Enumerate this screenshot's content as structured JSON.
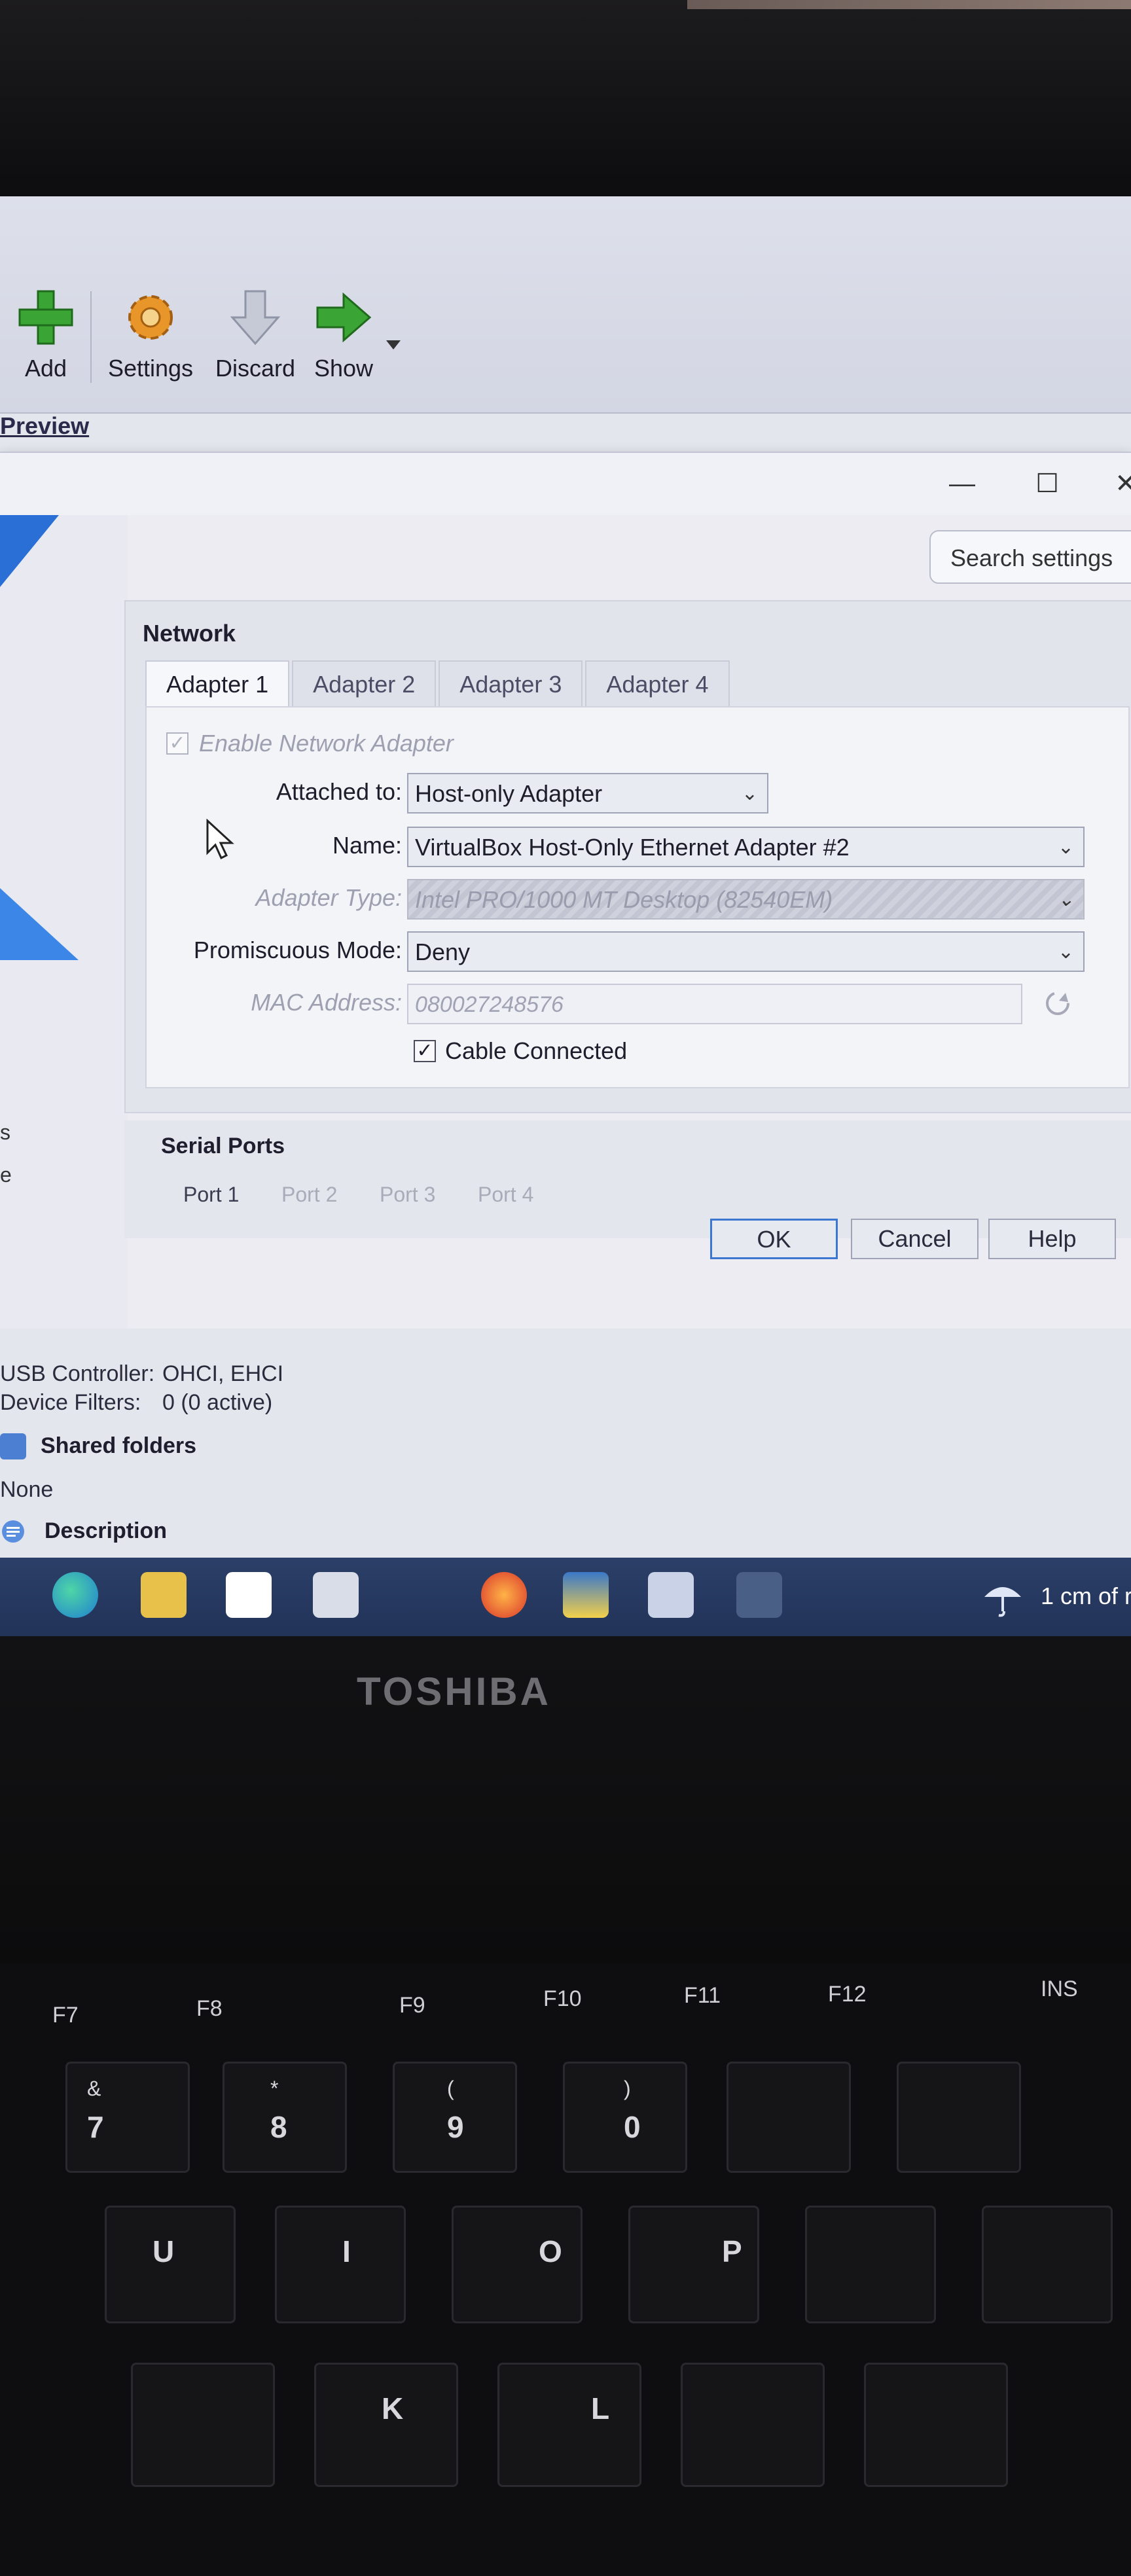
{
  "toolbar": {
    "add_label": "Add",
    "settings_label": "Settings",
    "discard_label": "Discard",
    "show_label": "Show"
  },
  "preview_label": "Preview",
  "dialog": {
    "minimize": "—",
    "maximize": "☐",
    "close": "✕",
    "search_placeholder": "Search settings",
    "network_title": "Network",
    "tabs": [
      "Adapter 1",
      "Adapter 2",
      "Adapter 3",
      "Adapter 4"
    ],
    "enable_adapter": "Enable Network Adapter",
    "attached_to_label": "Attached to:",
    "attached_to_value": "Host-only Adapter",
    "name_label": "Name:",
    "name_value": "VirtualBox Host-Only Ethernet Adapter #2",
    "adapter_type_label": "Adapter Type:",
    "adapter_type_value": "Intel PRO/1000 MT Desktop (82540EM)",
    "promiscuous_label": "Promiscuous Mode:",
    "promiscuous_value": "Deny",
    "mac_label": "MAC Address:",
    "mac_value": "080027248576",
    "cable_connected": "Cable Connected",
    "serial_title": "Serial Ports",
    "ports": [
      "Port 1",
      "Port 2",
      "Port 3",
      "Port 4"
    ],
    "ok": "OK",
    "cancel": "Cancel",
    "help": "Help",
    "left_letters": [
      "s",
      "e"
    ]
  },
  "details": {
    "usb_controller_label": "USB Controller:",
    "usb_controller_value": "OHCI, EHCI",
    "device_filters_label": "Device Filters:",
    "device_filters_value": "0 (0 active)",
    "shared_folders": "Shared folders",
    "none": "None",
    "description": "Description"
  },
  "taskbar": {
    "weather": "1 cm of r"
  },
  "laptop": {
    "brand": "TOSHIBA",
    "fkeys": [
      "F7",
      "F8",
      "F9",
      "F10",
      "F11",
      "F12",
      "INS"
    ],
    "number_keys": [
      {
        "main": "7",
        "shift": "&"
      },
      {
        "main": "8",
        "shift": "*"
      },
      {
        "main": "9",
        "shift": "("
      },
      {
        "main": "0",
        "shift": ")"
      }
    ],
    "letter_keys": [
      "U",
      "I",
      "O",
      "P",
      "K",
      "L"
    ]
  }
}
